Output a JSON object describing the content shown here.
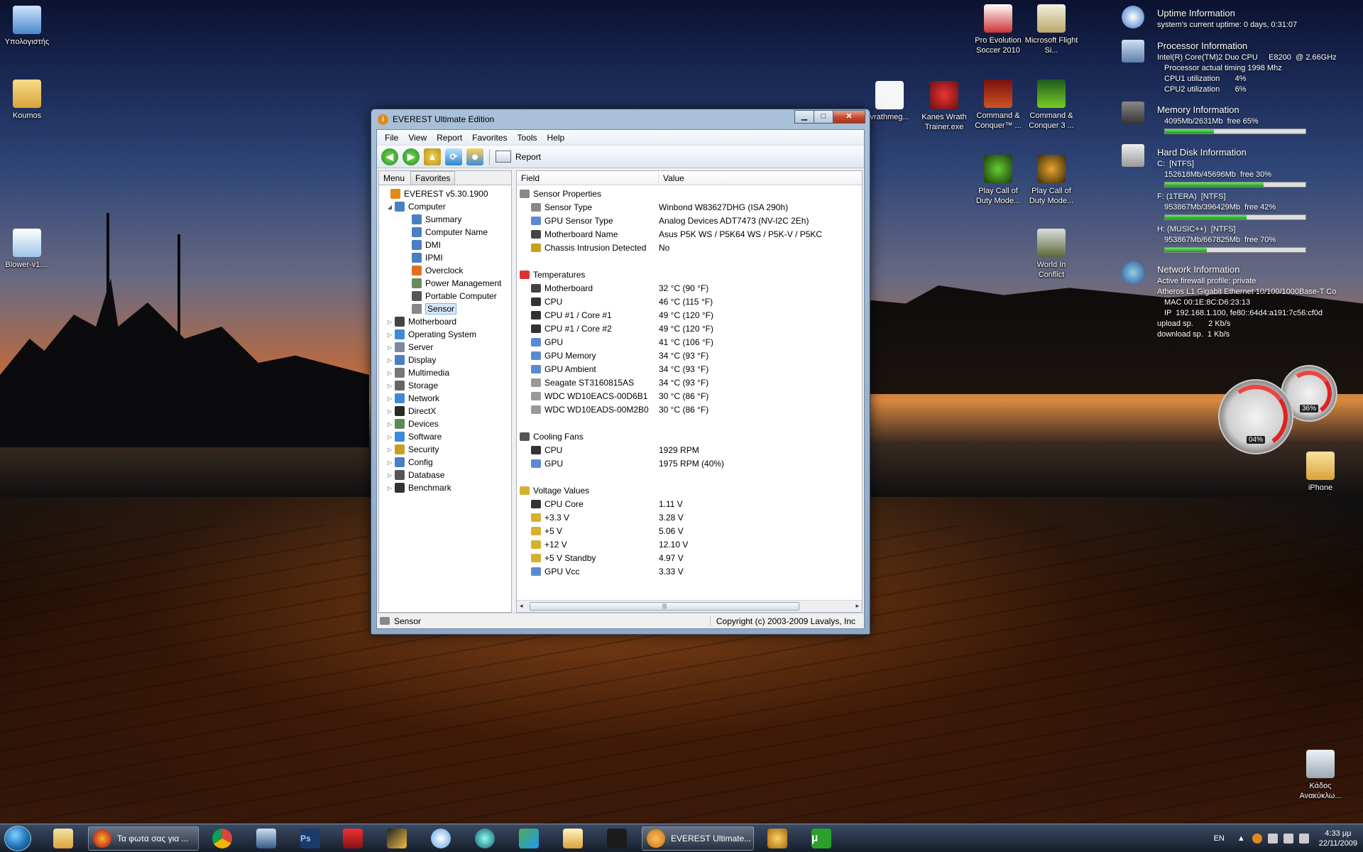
{
  "desktop": {
    "left_icons": [
      {
        "label": "Υπολογιστής",
        "icon": "computer-icon"
      },
      {
        "label": "Koumos",
        "icon": "user-folder-icon"
      },
      {
        "label": "Blower-v1....",
        "icon": "itunes-file-icon"
      }
    ],
    "top_icons": [
      {
        "label": "Pro Evolution Soccer 2010",
        "icon": "pes-game-icon"
      },
      {
        "label": "Microsoft Flight Si...",
        "icon": "flight-simulator-icon"
      },
      {
        "label": "vrathmeg...",
        "icon": "document-icon"
      },
      {
        "label": "Kanes Wrath Trainer.exe",
        "icon": "kanes-wrath-icon"
      },
      {
        "label": "Command & Conquer™ ...",
        "icon": "cnc-icon"
      },
      {
        "label": "Command & Conquer 3 ...",
        "icon": "cnc3-icon"
      },
      {
        "label": "Play Call of Duty Mode...",
        "icon": "cod-icon"
      },
      {
        "label": "Play Call of Duty Mode...",
        "icon": "cod-icon"
      },
      {
        "label": "World In Conflict",
        "icon": "world-in-conflict-icon"
      },
      {
        "label": "iPhone",
        "icon": "folder-icon"
      },
      {
        "label": "Κάδος Ανακύκλω...",
        "icon": "recycle-bin-icon"
      }
    ]
  },
  "gadget": {
    "uptime_title": "Uptime Information",
    "uptime_line": "system's current uptime: 0 days, 0:31:07",
    "proc_title": "Processor Information",
    "proc_cpu": "Intel(R) Core(TM)2 Duo CPU     E8200  @ 2.66GHz",
    "proc_timing": "Processor actual timing 1998 Mhz",
    "cpu1": "CPU1 utilization       4%",
    "cpu2": "CPU2 utilization       6%",
    "mem_title": "Memory Information",
    "mem_line": "4095Mb/2631Mb  free 65%",
    "mem_free": 0.35,
    "hdd_title": "Hard Disk Information",
    "disks": [
      {
        "name": "C:  [NTFS]",
        "usage": "152618Mb/45696Mb  free 30%",
        "used": 0.7
      },
      {
        "name": "F: (1TERA)  [NTFS]",
        "usage": "953867Mb/396429Mb  free 42%",
        "used": 0.58
      },
      {
        "name": "H: (MUSIC++)  [NTFS]",
        "usage": "953867Mb/667825Mb  free 70%",
        "used": 0.3
      }
    ],
    "net_title": "Network Information",
    "net_firewall": "Active firewall profile: private",
    "net_adapter": "Atheros L1 Gigabit Ethernet 10/100/1000Base-T Co",
    "net_mac": "MAC 00:1E:8C:D6:23:13",
    "net_ip": "IP  192.168.1.100, fe80::64d4:a191:7c56:cf0d",
    "net_up": "upload sp.       2 Kb/s",
    "net_down": "download sp.  1 Kb/s",
    "gauge_cpu": "04%",
    "gauge_mem": "36%"
  },
  "window": {
    "title": "EVEREST Ultimate Edition",
    "menu": [
      "File",
      "View",
      "Report",
      "Favorites",
      "Tools",
      "Help"
    ],
    "toolbar_report": "Report",
    "tabs": [
      "Menu",
      "Favorites"
    ],
    "tree": [
      {
        "label": "EVEREST v5.30.1900",
        "level": 0,
        "exp": "",
        "color": "#e08a1a"
      },
      {
        "label": "Computer",
        "level": 1,
        "exp": "◢",
        "color": "#4a7fc1"
      },
      {
        "label": "Summary",
        "level": 2,
        "exp": "",
        "color": "#4a7fc1"
      },
      {
        "label": "Computer Name",
        "level": 2,
        "exp": "",
        "color": "#4a7fc1"
      },
      {
        "label": "DMI",
        "level": 2,
        "exp": "",
        "color": "#4a7fc1"
      },
      {
        "label": "IPMI",
        "level": 2,
        "exp": "",
        "color": "#4a7fc1"
      },
      {
        "label": "Overclock",
        "level": 2,
        "exp": "",
        "color": "#e07020"
      },
      {
        "label": "Power Management",
        "level": 2,
        "exp": "",
        "color": "#6a8a5a"
      },
      {
        "label": "Portable Computer",
        "level": 2,
        "exp": "",
        "color": "#555"
      },
      {
        "label": "Sensor",
        "level": 2,
        "exp": "",
        "color": "#888",
        "selected": true
      },
      {
        "label": "Motherboard",
        "level": 1,
        "exp": "▷",
        "color": "#444"
      },
      {
        "label": "Operating System",
        "level": 1,
        "exp": "▷",
        "color": "#3d8ad6"
      },
      {
        "label": "Server",
        "level": 1,
        "exp": "▷",
        "color": "#7a8ca3"
      },
      {
        "label": "Display",
        "level": 1,
        "exp": "▷",
        "color": "#4a7fc1"
      },
      {
        "label": "Multimedia",
        "level": 1,
        "exp": "▷",
        "color": "#777"
      },
      {
        "label": "Storage",
        "level": 1,
        "exp": "▷",
        "color": "#666"
      },
      {
        "label": "Network",
        "level": 1,
        "exp": "▷",
        "color": "#3d8ad6"
      },
      {
        "label": "DirectX",
        "level": 1,
        "exp": "▷",
        "color": "#2a2a2a"
      },
      {
        "label": "Devices",
        "level": 1,
        "exp": "▷",
        "color": "#5a8a5a"
      },
      {
        "label": "Software",
        "level": 1,
        "exp": "▷",
        "color": "#3d8ad6"
      },
      {
        "label": "Security",
        "level": 1,
        "exp": "▷",
        "color": "#c8a020"
      },
      {
        "label": "Config",
        "level": 1,
        "exp": "▷",
        "color": "#4a7fc1"
      },
      {
        "label": "Database",
        "level": 1,
        "exp": "▷",
        "color": "#555"
      },
      {
        "label": "Benchmark",
        "level": 1,
        "exp": "▷",
        "color": "#333"
      }
    ],
    "columns": [
      "Field",
      "Value"
    ],
    "rows": [
      {
        "type": "group",
        "field": "Sensor Properties",
        "value": "",
        "icon": "sensor-icon"
      },
      {
        "type": "item",
        "field": "Sensor Type",
        "value": "Winbond W83627DHG  (ISA 290h)",
        "icon": "sensor-icon"
      },
      {
        "type": "item",
        "field": "GPU Sensor Type",
        "value": "Analog Devices ADT7473  (NV-I2C 2Eh)",
        "icon": "gpu-icon"
      },
      {
        "type": "item",
        "field": "Motherboard Name",
        "value": "Asus P5K WS / P5K64 WS / P5K-V / P5KC",
        "icon": "motherboard-icon"
      },
      {
        "type": "item",
        "field": "Chassis Intrusion Detected",
        "value": "No",
        "icon": "lock-icon"
      },
      {
        "type": "spacer"
      },
      {
        "type": "group",
        "field": "Temperatures",
        "value": "",
        "icon": "thermometer-icon"
      },
      {
        "type": "item",
        "field": "Motherboard",
        "value": "32 °C  (90 °F)",
        "icon": "motherboard-icon"
      },
      {
        "type": "item",
        "field": "CPU",
        "value": "46 °C  (115 °F)",
        "icon": "cpu-icon"
      },
      {
        "type": "item",
        "field": "CPU #1 / Core #1",
        "value": "49 °C  (120 °F)",
        "icon": "cpu-icon"
      },
      {
        "type": "item",
        "field": "CPU #1 / Core #2",
        "value": "49 °C  (120 °F)",
        "icon": "cpu-icon"
      },
      {
        "type": "item",
        "field": "GPU",
        "value": "41 °C  (106 °F)",
        "icon": "gpu-icon"
      },
      {
        "type": "item",
        "field": "GPU Memory",
        "value": "34 °C  (93 °F)",
        "icon": "gpu-icon"
      },
      {
        "type": "item",
        "field": "GPU Ambient",
        "value": "34 °C  (93 °F)",
        "icon": "gpu-icon"
      },
      {
        "type": "item",
        "field": "Seagate ST3160815AS",
        "value": "34 °C  (93 °F)",
        "icon": "hdd-icon"
      },
      {
        "type": "item",
        "field": "WDC WD10EACS-00D6B1",
        "value": "30 °C  (86 °F)",
        "icon": "hdd-icon"
      },
      {
        "type": "item",
        "field": "WDC WD10EADS-00M2B0",
        "value": "30 °C  (86 °F)",
        "icon": "hdd-icon"
      },
      {
        "type": "spacer"
      },
      {
        "type": "group",
        "field": "Cooling Fans",
        "value": "",
        "icon": "fan-icon"
      },
      {
        "type": "item",
        "field": "CPU",
        "value": "1929 RPM",
        "icon": "cpu-icon"
      },
      {
        "type": "item",
        "field": "GPU",
        "value": "1975 RPM  (40%)",
        "icon": "gpu-icon"
      },
      {
        "type": "spacer"
      },
      {
        "type": "group",
        "field": "Voltage Values",
        "value": "",
        "icon": "voltage-icon"
      },
      {
        "type": "item",
        "field": "CPU Core",
        "value": "1.11 V",
        "icon": "cpu-icon"
      },
      {
        "type": "item",
        "field": "+3.3 V",
        "value": "3.28 V",
        "icon": "voltage-icon"
      },
      {
        "type": "item",
        "field": "+5 V",
        "value": "5.06 V",
        "icon": "voltage-icon"
      },
      {
        "type": "item",
        "field": "+12 V",
        "value": "12.10 V",
        "icon": "voltage-icon"
      },
      {
        "type": "item",
        "field": "+5 V Standby",
        "value": "4.97 V",
        "icon": "voltage-icon"
      },
      {
        "type": "item",
        "field": "GPU Vcc",
        "value": "3.33 V",
        "icon": "gpu-icon"
      }
    ],
    "status_left": "Sensor",
    "status_right": "Copyright (c) 2003-2009 Lavalys, Inc"
  },
  "taskbar": {
    "tasks": [
      {
        "label": "Τα φωτα σας για ...",
        "icon": "firefox-icon"
      },
      {
        "label": "EVEREST Ultimate...",
        "icon": "everest-icon"
      }
    ],
    "lang": "EN",
    "time": "4:33 μμ",
    "date": "22/11/2009"
  }
}
